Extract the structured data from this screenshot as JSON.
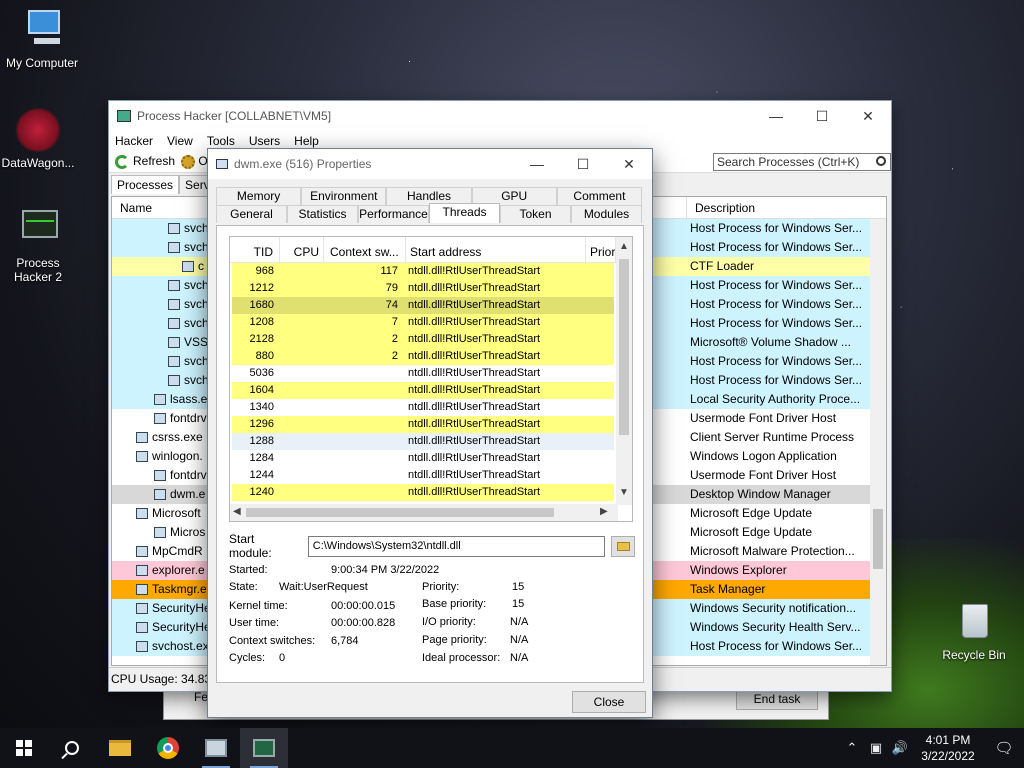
{
  "desktop": {
    "icons": [
      {
        "label": "My Computer"
      },
      {
        "label": "DataWagon..."
      },
      {
        "label": "Process Hacker 2"
      },
      {
        "label": "Recycle Bin"
      }
    ]
  },
  "main_window": {
    "title": "Process Hacker [COLLABNET\\VM5]",
    "menu": [
      "Hacker",
      "View",
      "Tools",
      "Users",
      "Help"
    ],
    "toolbar": {
      "refresh": "Refresh",
      "options_partial": "O"
    },
    "search_placeholder": "Search Processes (Ctrl+K)",
    "tabs": [
      "Processes",
      "Servic"
    ],
    "columns": {
      "name": "Name",
      "description": "Description"
    },
    "rows": [
      {
        "name": "svch",
        "desc": "Host Process for Windows Ser...",
        "color": "#cdf3ff"
      },
      {
        "name": "svch",
        "desc": "Host Process for Windows Ser...",
        "color": "#cdf3ff"
      },
      {
        "name": "c",
        "desc": "CTF Loader",
        "color": "#ffffa8"
      },
      {
        "name": "svch",
        "desc": "Host Process for Windows Ser...",
        "color": "#cdf3ff"
      },
      {
        "name": "svch",
        "desc": "Host Process for Windows Ser...",
        "color": "#cdf3ff"
      },
      {
        "name": "svch",
        "desc": "Host Process for Windows Ser...",
        "color": "#cdf3ff"
      },
      {
        "name": "VSS\\",
        "desc": "Microsoft® Volume Shadow ...",
        "color": "#cdf3ff"
      },
      {
        "name": "svch",
        "desc": "Host Process for Windows Ser...",
        "color": "#cdf3ff"
      },
      {
        "name": "svch",
        "desc": "Host Process for Windows Ser...",
        "color": "#cdf3ff"
      },
      {
        "name": "lsass.ex",
        "desc": "Local Security Authority Proce...",
        "color": "#cdf3ff"
      },
      {
        "name": "fontdrv",
        "desc": "Usermode Font Driver Host",
        "color": "#ffffff"
      },
      {
        "name": "csrss.exe",
        "desc": "Client Server Runtime Process",
        "color": "#ffffff"
      },
      {
        "name": "winlogon.",
        "desc": "Windows Logon Application",
        "color": "#ffffff"
      },
      {
        "name": "fontdrv",
        "desc": "Usermode Font Driver Host",
        "color": "#ffffff"
      },
      {
        "name": "dwm.e",
        "desc": "Desktop Window Manager",
        "color": "#d8d8d8"
      },
      {
        "name": "Microsoft",
        "desc": "Microsoft Edge Update",
        "color": "#ffffff"
      },
      {
        "name": "Micros",
        "desc": "Microsoft Edge Update",
        "color": "#ffffff"
      },
      {
        "name": "MpCmdR",
        "desc": "Microsoft Malware Protection...",
        "color": "#ffffff"
      },
      {
        "name": "explorer.e",
        "desc": "Windows Explorer",
        "color": "#ffc8d8"
      },
      {
        "name": "Taskmgr.e",
        "desc": "Task Manager",
        "color": "#ffa800"
      },
      {
        "name": "SecurityHe",
        "desc": "Windows Security notification...",
        "color": "#cdf3ff"
      },
      {
        "name": "SecurityHe",
        "desc": "Windows Security Health Serv...",
        "color": "#cdf3ff"
      },
      {
        "name": "svchost.ex",
        "desc": "Host Process for Windows Ser...",
        "color": "#cdf3ff"
      }
    ],
    "status": "CPU Usage: 34.83%"
  },
  "task_manager": {
    "fewer_partial": "Fe",
    "end_task": "End task"
  },
  "dialog": {
    "title": "dwm.exe (516) Properties",
    "tabs_row1": [
      "Memory",
      "Environment",
      "Handles",
      "GPU",
      "Comment"
    ],
    "tabs_row2": [
      "General",
      "Statistics",
      "Performance",
      "Threads",
      "Token",
      "Modules"
    ],
    "active_tab": "Threads",
    "columns": {
      "tid": "TID",
      "cpu": "CPU",
      "ctx": "Context sw...",
      "start": "Start address",
      "prio": "Prior"
    },
    "threads": [
      {
        "tid": "968",
        "cpu": "",
        "ctx": "117",
        "start": "ntdll.dll!RtlUserThreadStart",
        "style": "yellow"
      },
      {
        "tid": "1212",
        "cpu": "",
        "ctx": "79",
        "start": "ntdll.dll!RtlUserThreadStart",
        "style": "yellow"
      },
      {
        "tid": "1680",
        "cpu": "",
        "ctx": "74",
        "start": "ntdll.dll!RtlUserThreadStart",
        "style": "sel"
      },
      {
        "tid": "1208",
        "cpu": "",
        "ctx": "7",
        "start": "ntdll.dll!RtlUserThreadStart",
        "style": "yellow"
      },
      {
        "tid": "2128",
        "cpu": "",
        "ctx": "2",
        "start": "ntdll.dll!RtlUserThreadStart",
        "style": "yellow"
      },
      {
        "tid": "880",
        "cpu": "",
        "ctx": "2",
        "start": "ntdll.dll!RtlUserThreadStart",
        "style": "yellow"
      },
      {
        "tid": "5036",
        "cpu": "",
        "ctx": "",
        "start": "ntdll.dll!RtlUserThreadStart",
        "style": "white"
      },
      {
        "tid": "1604",
        "cpu": "",
        "ctx": "",
        "start": "ntdll.dll!RtlUserThreadStart",
        "style": "yellow"
      },
      {
        "tid": "1340",
        "cpu": "",
        "ctx": "",
        "start": "ntdll.dll!RtlUserThreadStart",
        "style": "white"
      },
      {
        "tid": "1296",
        "cpu": "",
        "ctx": "",
        "start": "ntdll.dll!RtlUserThreadStart",
        "style": "yellow"
      },
      {
        "tid": "1288",
        "cpu": "",
        "ctx": "",
        "start": "ntdll.dll!RtlUserThreadStart",
        "style": "blue"
      },
      {
        "tid": "1284",
        "cpu": "",
        "ctx": "",
        "start": "ntdll.dll!RtlUserThreadStart",
        "style": "white"
      },
      {
        "tid": "1244",
        "cpu": "",
        "ctx": "",
        "start": "ntdll.dll!RtlUserThreadStart",
        "style": "white"
      },
      {
        "tid": "1240",
        "cpu": "",
        "ctx": "",
        "start": "ntdll.dll!RtlUserThreadStart",
        "style": "yellow"
      }
    ],
    "start_module_label": "Start module:",
    "start_module_value": "C:\\Windows\\System32\\ntdll.dll",
    "info": {
      "started_label": "Started:",
      "started_value": "9:00:34 PM 3/22/2022",
      "state_label": "State:",
      "state_value": "Wait:UserRequest",
      "kernel_label": "Kernel time:",
      "kernel_value": "00:00:00.015",
      "user_label": "User time:",
      "user_value": "00:00:00.828",
      "ctx_label": "Context switches:",
      "ctx_value": "6,784",
      "cycles_label": "Cycles:",
      "cycles_value": "0",
      "priority_label": "Priority:",
      "priority_value": "15",
      "base_label": "Base priority:",
      "base_value": "15",
      "io_label": "I/O priority:",
      "io_value": "N/A",
      "page_label": "Page priority:",
      "page_value": "N/A",
      "ideal_label": "Ideal processor:",
      "ideal_value": "N/A"
    },
    "close": "Close"
  },
  "taskbar": {
    "time": "4:01 PM",
    "date": "3/22/2022",
    "tray_icons": [
      "chevron-up",
      "network",
      "volume"
    ]
  }
}
